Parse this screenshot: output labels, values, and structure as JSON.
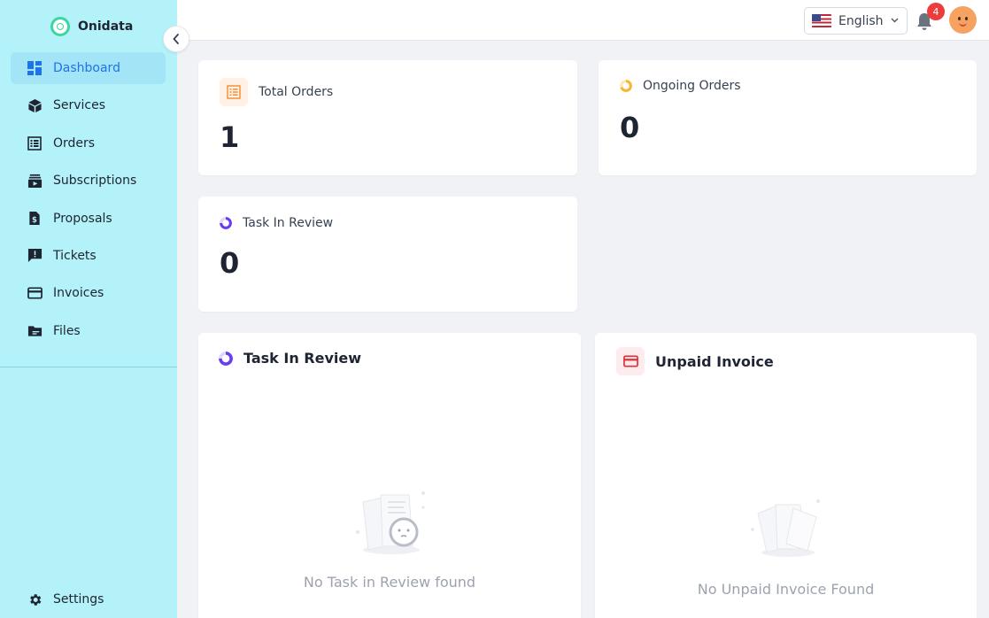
{
  "brand": {
    "name": "Onidata",
    "logo_icon": "onidata-logo-icon",
    "accent": "#3cd6a0"
  },
  "sidebar": {
    "items": [
      {
        "label": "Dashboard",
        "icon": "dashboard-icon",
        "active": true
      },
      {
        "label": "Services",
        "icon": "cube-icon"
      },
      {
        "label": "Orders",
        "icon": "list-icon"
      },
      {
        "label": "Subscriptions",
        "icon": "subscriptions-icon"
      },
      {
        "label": "Proposals",
        "icon": "dollar-file-icon"
      },
      {
        "label": "Tickets",
        "icon": "ticket-chat-icon"
      },
      {
        "label": "Invoices",
        "icon": "credit-card-icon"
      },
      {
        "label": "Files",
        "icon": "folder-icon"
      }
    ],
    "settings": {
      "label": "Settings",
      "icon": "gear-icon"
    },
    "background": "#b3f2f8",
    "active_color": "#1d74e8"
  },
  "topbar": {
    "language": {
      "selected": "English",
      "flag": "us-flag-icon"
    },
    "notifications": {
      "count": "4",
      "icon": "bell-icon",
      "badge_color": "#ee3b3b"
    },
    "avatar": "user-avatar"
  },
  "stats": {
    "total_orders": {
      "label": "Total Orders",
      "value": "1",
      "icon": "orders-list-icon",
      "color": "#f3923b"
    },
    "ongoing_orders": {
      "label": "Ongoing Orders",
      "value": "0",
      "icon": "ongoing-ring-icon",
      "color": "#f7b733"
    },
    "task_in_review": {
      "label": "Task In Review",
      "value": "0",
      "icon": "review-ring-icon",
      "color": "#6b3df0"
    }
  },
  "panels": {
    "task_in_review": {
      "title": "Task In Review",
      "empty_text": "No Task in Review found",
      "icon": "review-ring-icon"
    },
    "unpaid_invoice": {
      "title": "Unpaid Invoice",
      "empty_text": "No Unpaid Invoice Found",
      "icon": "credit-card-icon",
      "color": "#e0303a"
    }
  }
}
